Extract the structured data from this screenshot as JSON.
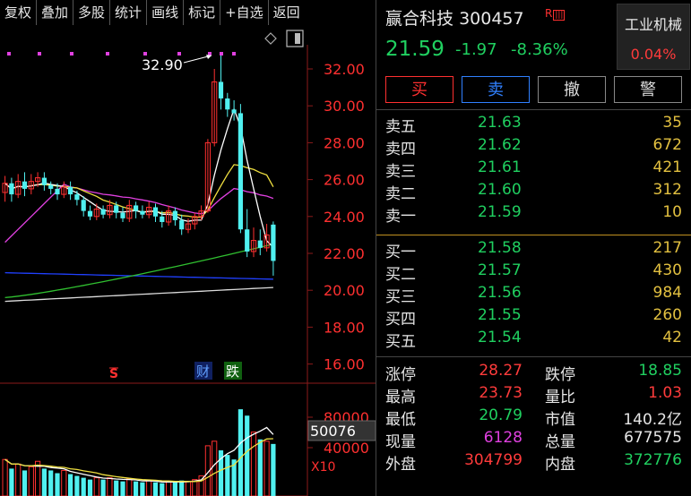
{
  "toolbar": {
    "items": [
      {
        "label": "复权"
      },
      {
        "label": "叠加"
      },
      {
        "label": "多股"
      },
      {
        "label": "统计"
      },
      {
        "label": "画线"
      },
      {
        "label": "标记"
      },
      {
        "label": "+自选"
      },
      {
        "label": "返回"
      }
    ]
  },
  "chart": {
    "max_marker": "32.90",
    "price_ticks": [
      "32.00",
      "30.00",
      "28.00",
      "26.00",
      "24.00",
      "22.00",
      "20.00",
      "18.00",
      "16.00"
    ],
    "vol_ticks": [
      "80000",
      "40000"
    ],
    "vol_readout": "50076",
    "vol_multiplier": "X10",
    "event_s": "S",
    "event_cai": "财",
    "event_die": "跌",
    "up_color": "#ff3030",
    "down_color": "#50f0f0",
    "ma5_color": "#ffffff",
    "ma10_color": "#f0e040",
    "ma20_color": "#e040e0",
    "ma60_color": "#30c030",
    "ma120_color": "#2040ff",
    "ma250_color": "#dddddd"
  },
  "quote": {
    "name": "赢合科技",
    "code": "300457",
    "badge": "R",
    "price": "21.59",
    "change": "-1.97",
    "change_pct": "-8.36%",
    "industry": "工业机械",
    "industry_pct": "0.04%"
  },
  "buttons": {
    "buy": "买",
    "sell": "卖",
    "cancel": "撤",
    "alert": "警"
  },
  "sell_book": [
    {
      "label": "卖五",
      "price": "21.63",
      "vol": "35"
    },
    {
      "label": "卖四",
      "price": "21.62",
      "vol": "672"
    },
    {
      "label": "卖三",
      "price": "21.61",
      "vol": "421"
    },
    {
      "label": "卖二",
      "price": "21.60",
      "vol": "312"
    },
    {
      "label": "卖一",
      "price": "21.59",
      "vol": "10"
    }
  ],
  "buy_book": [
    {
      "label": "买一",
      "price": "21.58",
      "vol": "217"
    },
    {
      "label": "买二",
      "price": "21.57",
      "vol": "430"
    },
    {
      "label": "买三",
      "price": "21.56",
      "vol": "984"
    },
    {
      "label": "买四",
      "price": "21.55",
      "vol": "260"
    },
    {
      "label": "买五",
      "price": "21.54",
      "vol": "42"
    }
  ],
  "stats": [
    {
      "l1": "涨停",
      "v1": "28.27",
      "c1": "#ff3b3b",
      "l2": "跌停",
      "v2": "18.85",
      "c2": "#20d060"
    },
    {
      "l1": "最高",
      "v1": "23.73",
      "c1": "#ff3b3b",
      "l2": "量比",
      "v2": "1.03",
      "c2": "#ff3b3b"
    },
    {
      "l1": "最低",
      "v1": "20.79",
      "c1": "#20d060",
      "l2": "市值",
      "v2": "140.2亿",
      "c2": "#e6e6e6"
    },
    {
      "l1": "现量",
      "v1": "6128",
      "c1": "#e040e0",
      "l2": "总量",
      "v2": "677575",
      "c2": "#e6e6e6"
    },
    {
      "l1": "外盘",
      "v1": "304799",
      "c1": "#ff3b3b",
      "l2": "内盘",
      "v2": "372776",
      "c2": "#20d060"
    }
  ]
}
